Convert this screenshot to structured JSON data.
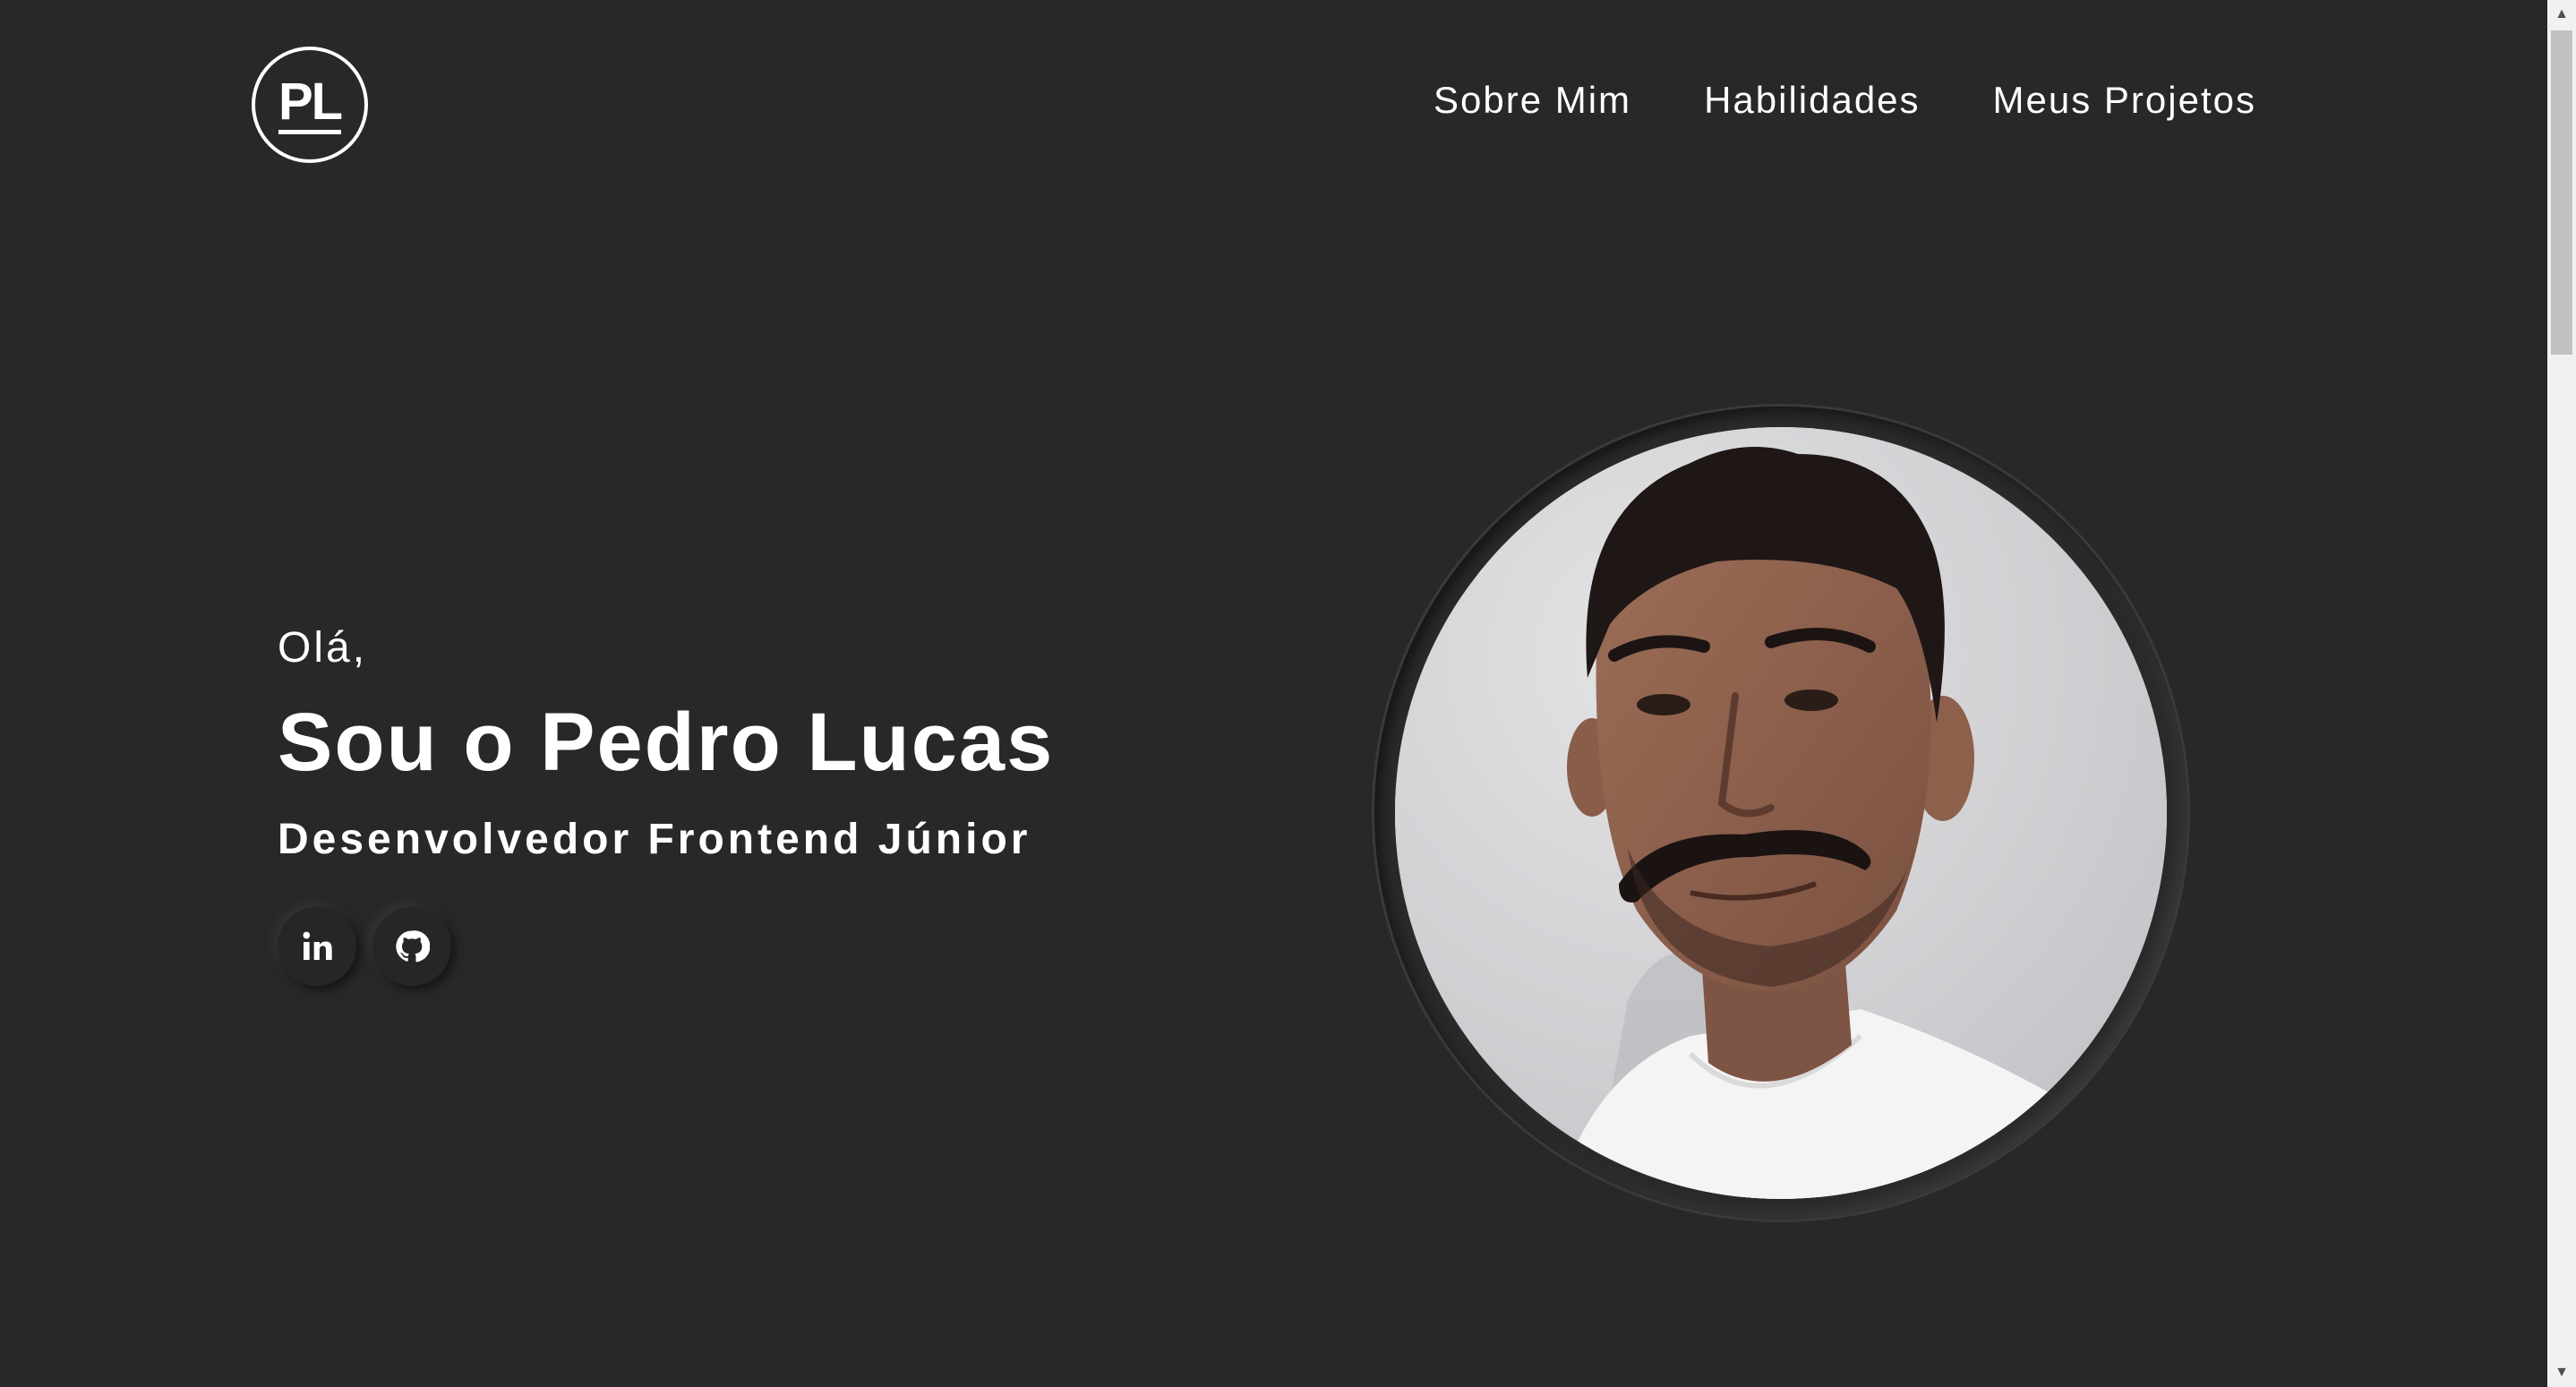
{
  "header": {
    "logo_text": "PL",
    "nav": [
      {
        "label": "Sobre Mim"
      },
      {
        "label": "Habilidades"
      },
      {
        "label": "Meus Projetos"
      }
    ]
  },
  "hero": {
    "greeting": "Olá,",
    "name": "Sou o Pedro Lucas",
    "role": "Desenvolvedor Frontend Júnior",
    "socials": [
      {
        "icon": "linkedin-icon"
      },
      {
        "icon": "github-icon"
      }
    ]
  },
  "colors": {
    "background": "#282828",
    "text": "#ffffff",
    "scrollbar_track": "#f1f1f1",
    "scrollbar_thumb": "#c1c1c1"
  },
  "scrollbar": {
    "up_glyph": "▲",
    "down_glyph": "▼"
  }
}
